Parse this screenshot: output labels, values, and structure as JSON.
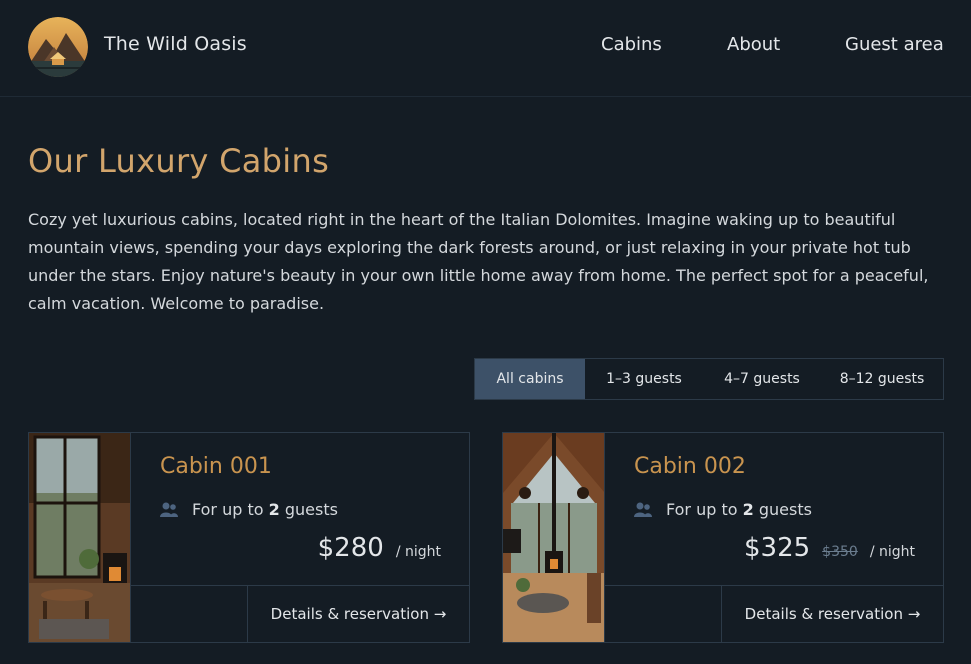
{
  "brand": {
    "name": "The Wild Oasis"
  },
  "nav": {
    "items": [
      "Cabins",
      "About",
      "Guest area"
    ]
  },
  "page": {
    "title": "Our Luxury Cabins",
    "intro": "Cozy yet luxurious cabins, located right in the heart of the Italian Dolomites. Imagine waking up to beautiful mountain views, spending your days exploring the dark forests around, or just relaxing in your private hot tub under the stars. Enjoy nature's beauty in your own little home away from home. The perfect spot for a peaceful, calm vacation. Welcome to paradise."
  },
  "filter": {
    "options": [
      "All cabins",
      "1–3 guests",
      "4–7 guests",
      "8–12 guests"
    ],
    "active": "All cabins"
  },
  "cabins": [
    {
      "name": "Cabin 001",
      "guests_prefix": "For up to",
      "guests_count": "2",
      "guests_suffix": "guests",
      "price": "$280",
      "old_price": "",
      "per_night": "/ night",
      "details": "Details & reservation →"
    },
    {
      "name": "Cabin 002",
      "guests_prefix": "For up to",
      "guests_count": "2",
      "guests_suffix": "guests",
      "price": "$325",
      "old_price": "$350",
      "per_night": "/ night",
      "details": "Details & reservation →"
    }
  ],
  "colors": {
    "background": "#141c24",
    "accent": "#d2a56c",
    "cabin_name": "#c9944f",
    "active_filter": "#3d5168",
    "border": "#2c3a48"
  }
}
